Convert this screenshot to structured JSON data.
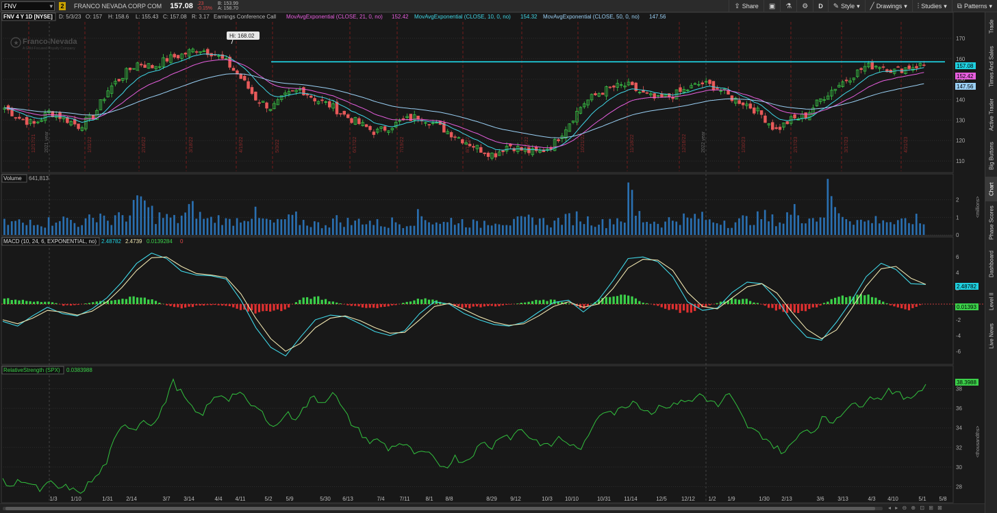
{
  "toolbar": {
    "symbol": "FNV",
    "link_number": "2",
    "company": "FRANCO NEVADA CORP COM",
    "last": "157.08",
    "change": ".23",
    "change_pct": "-0.15%",
    "bid": "B: 153.99",
    "ask": "A: 158.70",
    "buttons": [
      {
        "label": "Share",
        "icon": "share-icon"
      },
      {
        "label": "",
        "icon": "save-icon"
      },
      {
        "label": "",
        "icon": "flask-icon"
      },
      {
        "label": "",
        "icon": "gear-icon"
      },
      {
        "label": "D",
        "icon": ""
      },
      {
        "label": "Style",
        "icon": "style-icon"
      },
      {
        "label": "Drawings",
        "icon": "pencil-icon"
      },
      {
        "label": "Studies",
        "icon": "studies-icon"
      },
      {
        "label": "Patterns",
        "icon": "patterns-icon"
      }
    ]
  },
  "side_tabs": [
    "Trade",
    "Times And Sales",
    "Active Trader",
    "Big Buttons",
    "Chart",
    "Phase Scores",
    "Dashboard",
    "Level II",
    "Live News"
  ],
  "header": {
    "title": "FNV 4 Y 1D [NYSE]",
    "date": "D: 5/3/23",
    "open": "O: 157",
    "high": "H: 158.6",
    "low": "L: 155.43",
    "close": "C: 157.08",
    "range": "R: 3.17",
    "event": "Earnings Conference Call",
    "studies": [
      {
        "label": "MovAvgExponential (CLOSE, 21, 0, no)",
        "value": "152.42",
        "color": "#e85fe0"
      },
      {
        "label": "MovAvgExponential (CLOSE, 10, 0, no)",
        "value": "154.32",
        "color": "#40d8e8"
      },
      {
        "label": "MovAvgExponential (CLOSE, 50, 0, no)",
        "value": "147.56",
        "color": "#9ad0f5"
      }
    ]
  },
  "watermark": {
    "name": "Franco-Nevada",
    "tagline": "A Gold-Focused Royalty Company"
  },
  "hi_marker": "Hi: 168.02",
  "volume_header": {
    "label": "Volume",
    "value": "641,813"
  },
  "macd_header": {
    "label": "MACD (10, 24, 6, EXPONENTIAL, no)",
    "v1": "2.48782",
    "v2": "2.4739",
    "v3": "0.0139284",
    "v4": "0"
  },
  "rs_header": {
    "label": "RelativeStrength (SPX)",
    "value": "0.0383988"
  },
  "axis_units": {
    "volume": "<millions>",
    "rs": "<thousandths>"
  },
  "price_badges": [
    {
      "value": "157.08",
      "bg": "#1fd0e0"
    },
    {
      "value": "152.42",
      "bg": "#e85fe0"
    },
    {
      "value": "147.56",
      "bg": "#9ad0f5"
    }
  ],
  "macd_badges": [
    {
      "value": "2.48782",
      "bg": "#1fd0e0"
    },
    {
      "value": "0.01393",
      "bg": "#3cd24a"
    }
  ],
  "rs_badge": "38.3988",
  "x_labels": [
    "1/3",
    "1/10",
    "1/31",
    "2/14",
    "3/7",
    "3/14",
    "4/4",
    "4/11",
    "5/2",
    "5/9",
    "5/30",
    "6/13",
    "7/4",
    "7/11",
    "8/1",
    "8/8",
    "8/29",
    "9/12",
    "10/3",
    "10/10",
    "10/31",
    "11/14",
    "12/5",
    "12/12",
    "1/2",
    "1/9",
    "1/30",
    "2/13",
    "3/6",
    "3/13",
    "4/3",
    "4/10",
    "5/1",
    "5/8"
  ],
  "earnings_labels": [
    "12/17/21",
    "1/31/22",
    "2/16/22",
    "3/18/22",
    "4/19/22",
    "5/3/22",
    "6/17/22",
    "7/19/22",
    "8/11/22",
    "9/16/22",
    "10/21/22",
    "11/18/22",
    "12/16/22",
    "1/30/23",
    "2/17/23",
    "3/17/23",
    "4/21/23"
  ],
  "year_labels": [
    "2021 year",
    "2022 year"
  ],
  "chart_data": [
    {
      "type": "candlestick",
      "title": "FNV 4 Y 1D [NYSE]",
      "y_ticks": [
        110,
        120,
        130,
        140,
        150,
        160,
        170
      ],
      "ylim": [
        105,
        178
      ],
      "resistance_line": 158.5,
      "close_path": [
        [
          0,
          136
        ],
        [
          4,
          131
        ],
        [
          8,
          128
        ],
        [
          12,
          134
        ],
        [
          16,
          131
        ],
        [
          20,
          127
        ],
        [
          24,
          132
        ],
        [
          28,
          145
        ],
        [
          32,
          152
        ],
        [
          36,
          158
        ],
        [
          40,
          156
        ],
        [
          44,
          160
        ],
        [
          48,
          162
        ],
        [
          52,
          165
        ],
        [
          56,
          163
        ],
        [
          60,
          158
        ],
        [
          64,
          150
        ],
        [
          68,
          140
        ],
        [
          72,
          136
        ],
        [
          76,
          142
        ],
        [
          80,
          145
        ],
        [
          84,
          140
        ],
        [
          88,
          137
        ],
        [
          92,
          132
        ],
        [
          96,
          128
        ],
        [
          100,
          124
        ],
        [
          104,
          127
        ],
        [
          108,
          130
        ],
        [
          112,
          132
        ],
        [
          116,
          128
        ],
        [
          120,
          124
        ],
        [
          124,
          120
        ],
        [
          128,
          116
        ],
        [
          132,
          113
        ],
        [
          136,
          118
        ],
        [
          140,
          115
        ],
        [
          144,
          114
        ],
        [
          148,
          118
        ],
        [
          152,
          128
        ],
        [
          156,
          138
        ],
        [
          160,
          143
        ],
        [
          164,
          146
        ],
        [
          168,
          147
        ],
        [
          172,
          143
        ],
        [
          176,
          140
        ],
        [
          180,
          142
        ],
        [
          184,
          145
        ],
        [
          188,
          148
        ],
        [
          192,
          146
        ],
        [
          196,
          141
        ],
        [
          200,
          138
        ],
        [
          204,
          133
        ],
        [
          208,
          125
        ],
        [
          212,
          130
        ],
        [
          216,
          132
        ],
        [
          220,
          140
        ],
        [
          224,
          146
        ],
        [
          228,
          151
        ],
        [
          232,
          156
        ],
        [
          236,
          157
        ],
        [
          240,
          154
        ],
        [
          244,
          156
        ],
        [
          248,
          157
        ]
      ]
    },
    {
      "type": "bar",
      "title": "Volume",
      "ylabel": "<millions>",
      "y_ticks": [
        0,
        1,
        2
      ],
      "ylim": [
        0,
        3
      ],
      "values": [
        0.7,
        0.8,
        0.6,
        0.9,
        0.7,
        0.8,
        1.1,
        0.9,
        0.7,
        0.8,
        0.9,
        1.3,
        0.8,
        1.0,
        1.2,
        1.7,
        2.1,
        1.4,
        1.1,
        1.0,
        0.9,
        1.2,
        1.5,
        1.1,
        0.9,
        1.0,
        0.8,
        0.9,
        1.1,
        1.2,
        0.9,
        0.8,
        0.7,
        0.9,
        1.0,
        0.8,
        0.7,
        0.6,
        0.7,
        0.9,
        0.8,
        0.7,
        0.9,
        0.8,
        0.7,
        0.6,
        0.8,
        0.7,
        0.9,
        1.1,
        1.0,
        0.8,
        0.7,
        0.9,
        0.8,
        0.7,
        0.6,
        0.8,
        0.9,
        0.8,
        0.7,
        0.8,
        0.9,
        1.0,
        0.8,
        0.7,
        0.9,
        1.0,
        1.1,
        0.9,
        0.8,
        0.7,
        0.9,
        1.0,
        2.3,
        1.2,
        0.9,
        0.8,
        0.7,
        0.9,
        1.0,
        0.9,
        1.1,
        1.0,
        0.8,
        0.9,
        0.7,
        0.8,
        0.9,
        1.0,
        1.1,
        0.9,
        0.8,
        1.2,
        1.4,
        1.1,
        1.0,
        1.3,
        2.5,
        1.4,
        1.1,
        0.9,
        0.8,
        0.9,
        1.0,
        0.8,
        0.7,
        0.8,
        0.9,
        0.7
      ]
    },
    {
      "type": "line",
      "title": "MACD (10, 24, 6, EXPONENTIAL, no)",
      "y_ticks": [
        -6,
        -4,
        -2,
        2,
        4,
        6
      ],
      "ylim": [
        -7.5,
        7.5
      ],
      "series": [
        {
          "values": [
            -2.2,
            -2.8,
            -1.5,
            -0.4,
            -1.2,
            -1.5,
            -0.6,
            0.8,
            2.8,
            5.2,
            6.5,
            5.8,
            4.2,
            3.7,
            3.6,
            3.2,
            0.5,
            -3.0,
            -5.5,
            -6.6,
            -4.2,
            -2.0,
            -1.4,
            -1.6,
            -2.5,
            -3.5,
            -4.0,
            -3.4,
            -1.2,
            0.3,
            0.0,
            -1.2,
            -2.0,
            -2.6,
            -2.8,
            -2.3,
            -1.0,
            0.2,
            0.5,
            -1.0,
            0.5,
            3.0,
            5.8,
            6.0,
            5.4,
            3.5,
            0.3,
            -0.8,
            -0.5,
            1.5,
            2.8,
            2.6,
            0.6,
            -2.2,
            -4.2,
            -4.6,
            -2.3,
            0.4,
            3.5,
            5.2,
            4.4,
            2.6,
            2.5
          ]
        },
        {
          "values": [
            -2.0,
            -2.5,
            -1.8,
            -0.8,
            -1.0,
            -1.4,
            -0.9,
            0.3,
            2.1,
            4.3,
            5.9,
            6.0,
            4.8,
            3.9,
            3.7,
            3.4,
            1.3,
            -1.8,
            -4.4,
            -6.0,
            -5.0,
            -3.0,
            -1.8,
            -1.5,
            -2.1,
            -3.0,
            -3.7,
            -3.6,
            -2.0,
            -0.3,
            0.1,
            -0.7,
            -1.6,
            -2.3,
            -2.7,
            -2.5,
            -1.5,
            -0.3,
            0.3,
            -0.4,
            0.0,
            2.0,
            4.6,
            5.7,
            5.6,
            4.3,
            1.5,
            -0.3,
            -0.6,
            0.8,
            2.2,
            2.6,
            1.4,
            -1.0,
            -3.2,
            -4.4,
            -3.3,
            -0.6,
            2.3,
            4.5,
            4.8,
            3.3,
            2.5
          ]
        }
      ],
      "histogram": [
        0.8,
        0.6,
        0.3,
        0.4,
        -0.2,
        -0.1,
        0.3,
        0.5,
        0.7,
        0.9,
        0.6,
        -0.2,
        -0.6,
        -0.2,
        -0.1,
        -0.2,
        -0.8,
        -1.2,
        -1.1,
        -0.6,
        0.8,
        1.0,
        0.4,
        -0.1,
        -0.4,
        -0.5,
        -0.3,
        0.2,
        0.8,
        0.6,
        -0.1,
        -0.5,
        -0.4,
        -0.3,
        -0.1,
        0.2,
        0.5,
        0.5,
        0.2,
        -0.6,
        0.5,
        1.0,
        1.2,
        0.3,
        -0.2,
        -0.8,
        -1.2,
        -0.5,
        0.1,
        0.7,
        0.6,
        0.0,
        -0.8,
        -1.2,
        -1.0,
        -0.2,
        1.0,
        1.0,
        1.2,
        0.7,
        -0.4,
        -0.7,
        0.0
      ]
    },
    {
      "type": "line",
      "title": "RelativeStrength (SPX)",
      "ylabel": "<thousandths>",
      "y_ticks": [
        28,
        30,
        32,
        34,
        36,
        38
      ],
      "ylim": [
        26.5,
        39.5
      ],
      "values": [
        28.5,
        28.0,
        28.8,
        28.2,
        27.6,
        28.4,
        27.8,
        28.0,
        27.2,
        28.2,
        29.0,
        30.5,
        33.0,
        34.5,
        33.8,
        35.0,
        34.2,
        36.0,
        38.8,
        37.5,
        36.0,
        35.2,
        36.5,
        37.5,
        37.0,
        37.8,
        36.5,
        36.0,
        35.0,
        34.0,
        35.5,
        35.0,
        36.0,
        37.2,
        36.5,
        37.8,
        36.0,
        34.5,
        33.5,
        32.5,
        32.8,
        31.8,
        32.5,
        32.0,
        31.2,
        31.5,
        30.5,
        30.0,
        31.0,
        30.5,
        31.5,
        32.5,
        32.0,
        33.5,
        33.0,
        34.0,
        33.0,
        32.5,
        32.0,
        33.0,
        32.5,
        31.8,
        32.5,
        35.0,
        36.0,
        35.5,
        36.2,
        36.8,
        36.0,
        35.5,
        36.5,
        36.0,
        37.0,
        36.5,
        37.5,
        36.8,
        36.2,
        37.5,
        36.0,
        34.2,
        33.5,
        33.0,
        32.0,
        31.5,
        32.5,
        34.0,
        33.5,
        35.0,
        34.5,
        35.5,
        36.5,
        36.0,
        37.5,
        36.8,
        38.0,
        37.5,
        36.8,
        37.6,
        38.5
      ]
    }
  ]
}
